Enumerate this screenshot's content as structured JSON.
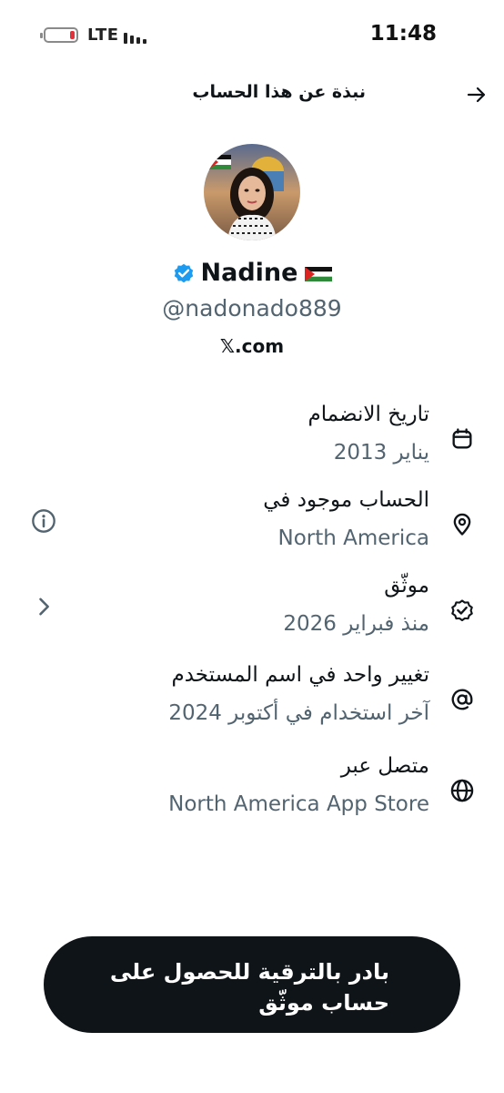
{
  "status_bar": {
    "network": "LTE",
    "time": "11:48",
    "battery_level": 0.15,
    "battery_color": "#e0323c"
  },
  "header": {
    "title": "نبذة عن هذا الحساب",
    "back_icon": "arrow-right-icon"
  },
  "profile": {
    "display_name": "Nadine",
    "handle": "@nadonado889",
    "website": "𝕏.com",
    "verified_color": "#1d9bf0",
    "flag": "palestine-flag"
  },
  "info": [
    {
      "title": "تاريخ الانضمام",
      "value": "يناير 2013",
      "icon": "calendar-icon",
      "trailing": ""
    },
    {
      "title": "الحساب موجود في",
      "value": "North America",
      "icon": "location-pin-icon",
      "trailing": "info-icon"
    },
    {
      "title": "موثّق",
      "value": "منذ فبراير 2026",
      "icon": "verified-check-icon",
      "trailing": "chevron-left-icon"
    },
    {
      "title": "تغيير واحد في اسم المستخدم",
      "value": "آخر استخدام في أكتوبر 2024",
      "icon": "at-sign-icon",
      "trailing": ""
    },
    {
      "title": "متصل عبر",
      "value": "North America App Store",
      "icon": "globe-icon",
      "trailing": ""
    }
  ],
  "upgrade": {
    "label": "بادر بالترقية للحصول على حساب موثّق"
  },
  "colors": {
    "text_primary": "#0f1419",
    "text_secondary": "#536471",
    "button_bg": "#0f1419"
  }
}
